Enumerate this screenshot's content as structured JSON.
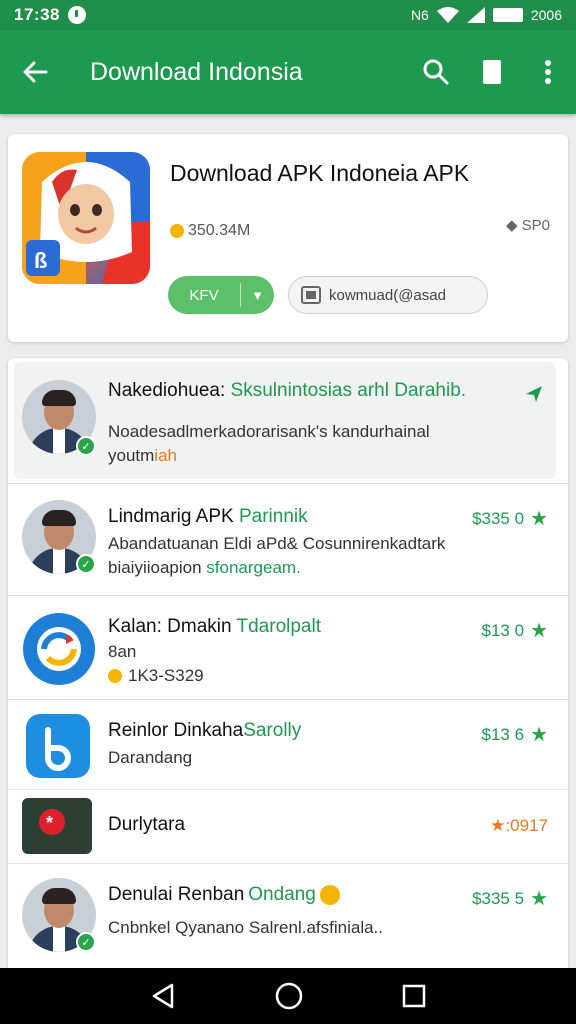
{
  "status_bar": {
    "time": "17:38",
    "right_text": "N6",
    "battery_text": "2006"
  },
  "app_bar": {
    "title": "Download Indonsia"
  },
  "app": {
    "title": "Download APK Indoneia APK",
    "size": "350.34M",
    "rank": "SP0",
    "install_label": "KFV",
    "kom_label": "kowmuad(@asad"
  },
  "list": [
    {
      "title": "Nakediohuea: ",
      "title_green": "Sksulnintosias arhl Darahib.",
      "sub1": "Noadesadlmerkadorarisank's kandurhainal",
      "sub2": "youtm",
      "sub2_orange": "iah",
      "price": ""
    },
    {
      "title": "Lindmarig APK ",
      "title_green": "Parinnik",
      "sub1": "Abandatuanan Eldi aPd& Cosunnirenkadtark",
      "sub2": "biaiyiioapion ",
      "sub2_green": "sfonargeam.",
      "price": "$335 0"
    },
    {
      "title": "Kalan: Dmakin ",
      "title_green": "Tdarolpalt",
      "sub1": "8an",
      "sub2": "1K3-S329",
      "price": "$13 0"
    },
    {
      "title": "Reinlor Dinkaha",
      "title_green": "Sarolly",
      "sub1": "Darandang",
      "price": "$13 6"
    },
    {
      "title": "Durlytara",
      "price": "★:0917"
    },
    {
      "title": "Denulai Renban ",
      "title_green": "Ondang",
      "sub1": "Cnbnkel  Qyanano Salrenl.afsfiniala..",
      "price": "$335 5"
    }
  ],
  "colors": {
    "primary": "#1e9a50",
    "accent_orange": "#e9771e",
    "star_green": "#2aa34a"
  }
}
